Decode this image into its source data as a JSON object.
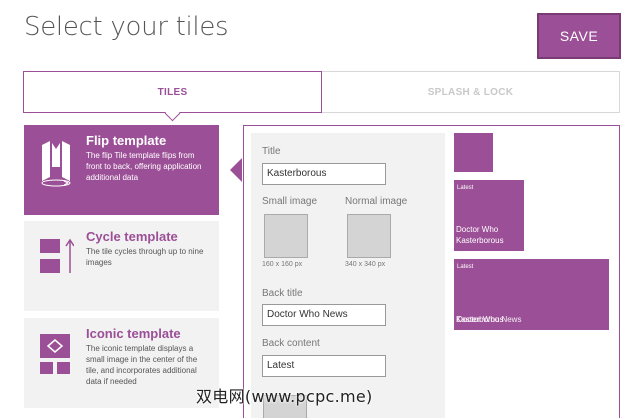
{
  "header": {
    "title": "Select your tiles",
    "save_label": "SAVE"
  },
  "tabs": [
    {
      "label": "TILES",
      "active": true
    },
    {
      "label": "SPLASH & LOCK",
      "active": false
    }
  ],
  "templates": [
    {
      "title": "Flip template",
      "description": "The flip Tile template flips from front to back, offering application additional data",
      "icon": "flip-icon",
      "selected": true
    },
    {
      "title": "Cycle template",
      "description": "The tile cycles through up to nine images",
      "icon": "cycle-icon",
      "selected": false
    },
    {
      "title": "Iconic template",
      "description": "The iconic template displays a small image in the center of the tile, and incorporates additional data if needed",
      "icon": "iconic-icon",
      "selected": false
    }
  ],
  "form": {
    "title_label": "Title",
    "title_value": "Kasterborous",
    "small_image_label": "Small image",
    "small_image_size": "160 x 160 px",
    "normal_image_label": "Normal image",
    "normal_image_size": "340 x 340 px",
    "back_title_label": "Back title",
    "back_title_value": "Doctor Who News",
    "back_content_label": "Back content",
    "back_content_value": "Latest"
  },
  "preview": {
    "medium_small_text": "Latest",
    "medium_line1": "Doctor Who",
    "medium_line2": "Kasterborous",
    "wide_small_text": "Latest",
    "wide_line1": "Kasterborous",
    "wide_line2": "Doctor Who News"
  },
  "watermark": "双电网(www.pcpc.me)",
  "colors": {
    "accent": "#9b4f96",
    "panel": "#f2f2f2"
  }
}
